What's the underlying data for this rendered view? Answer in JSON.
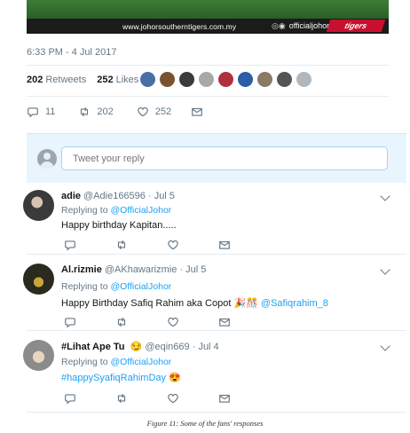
{
  "banner": {
    "url": "www.johorsoutherntigers.com.my",
    "handle": "officialjohor",
    "logo": "tigers"
  },
  "tweet": {
    "timestamp": "6:33 PM - 4 Jul 2017",
    "retweets_count": "202",
    "retweets_label": "Retweets",
    "likes_count": "252",
    "likes_label": "Likes",
    "actions": {
      "replies": "11",
      "retweets": "202",
      "likes": "252"
    }
  },
  "likers": [
    "#4a6fa5",
    "#7a5230",
    "#3b3b3b",
    "#a9a9a9",
    "#b03040",
    "#2d5ca8",
    "#8a7a66",
    "#555555",
    "#b0b7bd"
  ],
  "reply_box": {
    "placeholder": "Tweet your reply"
  },
  "replies": [
    {
      "name": "adie",
      "handle": "@Adie166596",
      "date": "· Jul 5",
      "replying_to": "Replying to",
      "mention": "@OfficialJohor",
      "text": "Happy birthday Kapitan.....",
      "avatar_color": "#3a3a3a"
    },
    {
      "name": "Al.rizmie",
      "handle": "@AKhawarizmie",
      "date": "· Jul 5",
      "replying_to": "Replying to",
      "mention": "@OfficialJohor",
      "text": "Happy Birthday Safiq Rahim aka Copot",
      "emoji": "🎉🎊",
      "link": "@Safiqrahim_8",
      "avatar_color": "#2b2a1f"
    },
    {
      "name": "#Lihat Ape Tu",
      "name_emoji": "😏",
      "handle": "@eqin669",
      "date": "· Jul 4",
      "replying_to": "Replying to",
      "mention": "@OfficialJohor",
      "link": "#happySyafiqRahimDay",
      "emoji": "😍",
      "avatar_color": "#c9b8a6"
    }
  ],
  "caption": "Figure 11: Some of the fans' responses"
}
